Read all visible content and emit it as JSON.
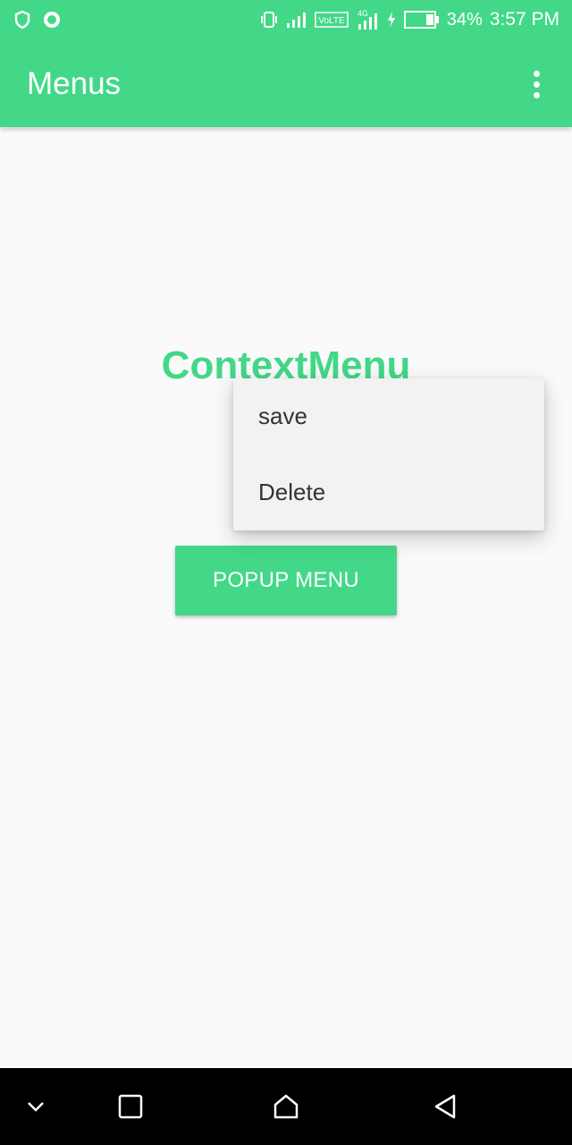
{
  "status_bar": {
    "battery": "34%",
    "time": "3:57 PM",
    "network_label": "VoLTE",
    "network_gen": "4G",
    "icons": [
      "shield-icon",
      "circle-notification-icon",
      "vibrate-icon",
      "signal-icon",
      "volte-icon",
      "signal-4g-icon",
      "charging-icon",
      "battery-icon"
    ]
  },
  "app_bar": {
    "title": "Menus",
    "overflow_icon": "more-vert-icon"
  },
  "main": {
    "context_text": "ContextMenu",
    "popup_button_label": "POPUP MENU"
  },
  "context_menu": {
    "items": [
      {
        "label": "save"
      },
      {
        "label": "Delete"
      }
    ]
  },
  "nav_bar": {
    "icons": [
      "chevron-down-icon",
      "recents-icon",
      "home-icon",
      "back-icon"
    ]
  },
  "colors": {
    "accent": "#42d888",
    "background": "#fafafa",
    "menu_bg": "#f2f2f2"
  }
}
